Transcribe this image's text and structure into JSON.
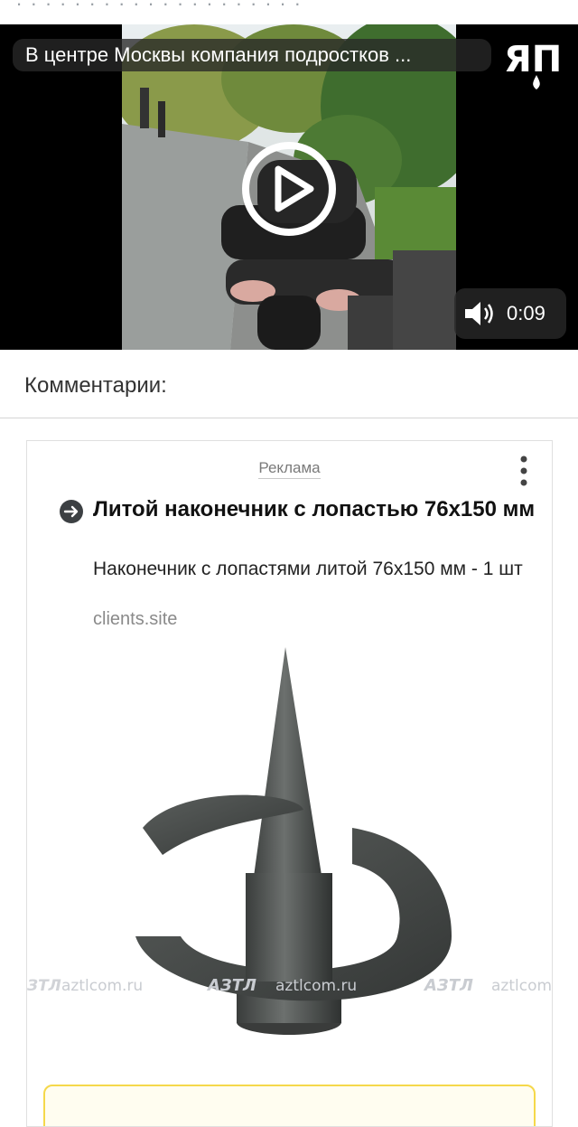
{
  "video": {
    "title": "В центре Москвы компания подростков ...",
    "brand_logo_text": "ЯП",
    "duration": "0:09",
    "play_icon": "play-circle-icon",
    "volume_icon": "speaker-icon"
  },
  "comments": {
    "header": "Комментарии:"
  },
  "ad": {
    "label": "Реклама",
    "title": "Литой наконечник с лопастью 76х150 мм",
    "description": "Наконечник с лопастями литой 76х150 мм - 1 шт",
    "domain": "clients.site",
    "watermark": "aztlcom.ru",
    "watermark_logo": "АЗТЛ",
    "colors": {
      "cta_border": "#f5d84a",
      "arrow_bg": "#3c4043"
    }
  }
}
